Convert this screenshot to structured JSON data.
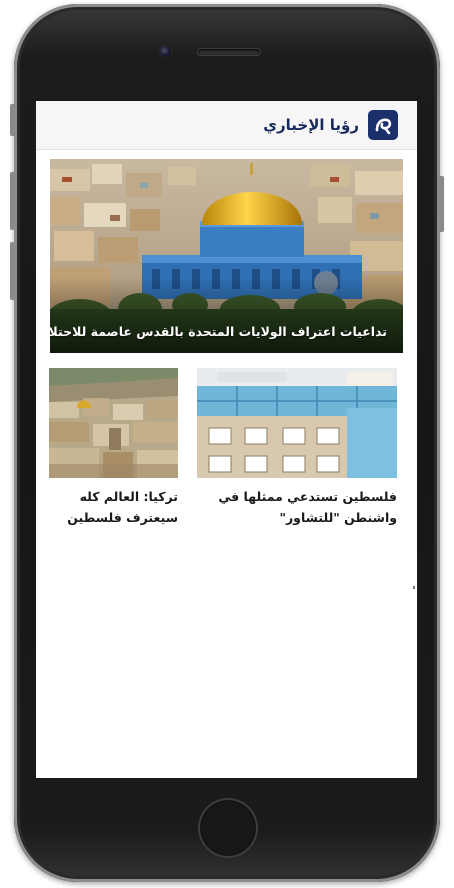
{
  "header": {
    "site_name": "رؤيا الإخباري",
    "logo_icon": "roya-logo-icon",
    "brand_color": "#1b2f6a"
  },
  "featured": {
    "title": "تداعيات اعتراف الولايات المتحدة بالقدس عاصمة للاحتلال"
  },
  "articles": [
    {
      "title": "فلسطين تستدعي ممثلها في واشنطن \"للتشاور\""
    },
    {
      "title": "تركيا: العالم كله سيعترف فلسطين"
    }
  ]
}
